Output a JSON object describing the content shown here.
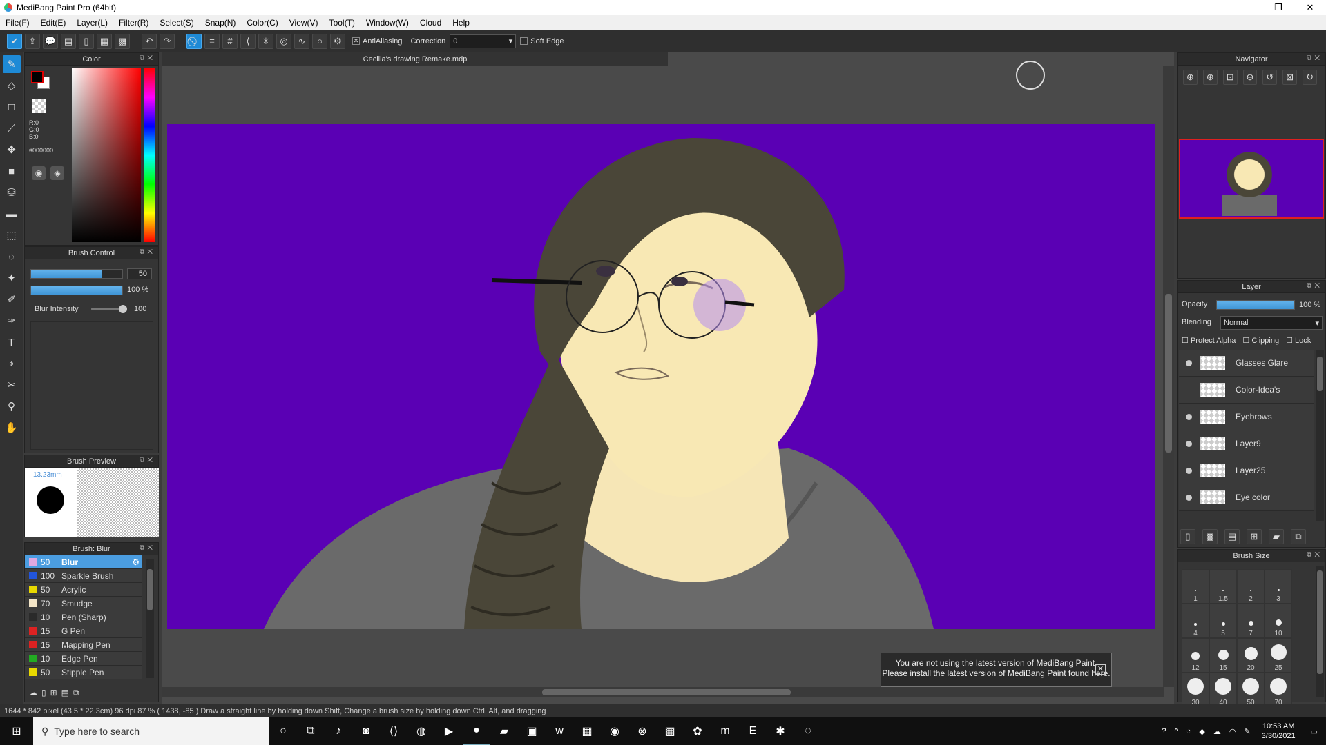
{
  "window": {
    "title": "MediBang Paint Pro (64bit)",
    "minimize": "–",
    "maximize": "❐",
    "close": "✕"
  },
  "menu": [
    "File(F)",
    "Edit(E)",
    "Layer(L)",
    "Filter(R)",
    "Select(S)",
    "Snap(N)",
    "Color(C)",
    "View(V)",
    "Tool(T)",
    "Window(W)",
    "Cloud",
    "Help"
  ],
  "toolbar": {
    "antialiasing_label": "AntiAliasing",
    "correction_label": "Correction",
    "correction_value": "0",
    "soft_edge_label": "Soft Edge"
  },
  "color_panel": {
    "title": "Color",
    "r": "R:0",
    "g": "G:0",
    "b": "B:0",
    "hex": "#000000",
    "fg_color": "#000000",
    "bg_color": "#ffffff"
  },
  "brush_control": {
    "title": "Brush Control",
    "size_value": "50",
    "size_fill": 0.78,
    "opacity_value": "100 %",
    "opacity_fill": 1.0,
    "intensity_label": "Blur Intensity",
    "intensity_value": "100"
  },
  "brush_preview": {
    "title": "Brush Preview",
    "size_text": "13.23mm"
  },
  "brush_list": {
    "title": "Brush: Blur",
    "items": [
      {
        "size": "50",
        "name": "Blur",
        "color": "#e0a8e0",
        "selected": true
      },
      {
        "size": "100",
        "name": "Sparkle Brush",
        "color": "#2255dd"
      },
      {
        "size": "50",
        "name": "Acrylic",
        "color": "#e8d800"
      },
      {
        "size": "70",
        "name": "Smudge",
        "color": "#f4e6c8"
      },
      {
        "size": "10",
        "name": "Pen (Sharp)",
        "color": "#2a2a2a"
      },
      {
        "size": "15",
        "name": "G Pen",
        "color": "#dd2222"
      },
      {
        "size": "15",
        "name": "Mapping Pen",
        "color": "#dd2222"
      },
      {
        "size": "10",
        "name": "Edge Pen",
        "color": "#22aa22"
      },
      {
        "size": "50",
        "name": "Stipple Pen",
        "color": "#e8d800"
      }
    ]
  },
  "document": {
    "tab": "Cecilia's drawing Remake.mdp",
    "bg_color": "#5a00b4"
  },
  "notice": {
    "line1": "You are not using the latest version of MediBang Paint.",
    "line2": "Please install the latest version of MediBang Paint found here."
  },
  "navigator": {
    "title": "Navigator"
  },
  "layer_panel": {
    "title": "Layer",
    "opacity_label": "Opacity",
    "opacity_value": "100 %",
    "blending_label": "Blending",
    "blending_value": "Normal",
    "protect_alpha": "Protect Alpha",
    "clipping": "Clipping",
    "lock": "Lock",
    "layers": [
      {
        "name": "Glasses Glare",
        "visible": true
      },
      {
        "name": "Color-Idea's",
        "visible": false
      },
      {
        "name": "Eyebrows",
        "visible": true
      },
      {
        "name": "Layer9",
        "visible": true
      },
      {
        "name": "Layer25",
        "visible": true
      },
      {
        "name": "Eye color",
        "visible": true
      }
    ]
  },
  "brush_size_panel": {
    "title": "Brush Size",
    "sizes": [
      "1",
      "1.5",
      "2",
      "3",
      "4",
      "5",
      "7",
      "10",
      "12",
      "15",
      "20",
      "25",
      "30",
      "40",
      "50",
      "70"
    ]
  },
  "status": {
    "text": "1644 * 842 pixel   (43.5 * 22.3cm)   96 dpi   87 %   ( 1438, -85 )   Draw a straight line by holding down Shift, Change a brush size by holding down Ctrl, Alt, and dragging"
  },
  "taskbar": {
    "search_placeholder": "Type here to search",
    "time": "10:53 AM",
    "date": "3/30/2021"
  }
}
